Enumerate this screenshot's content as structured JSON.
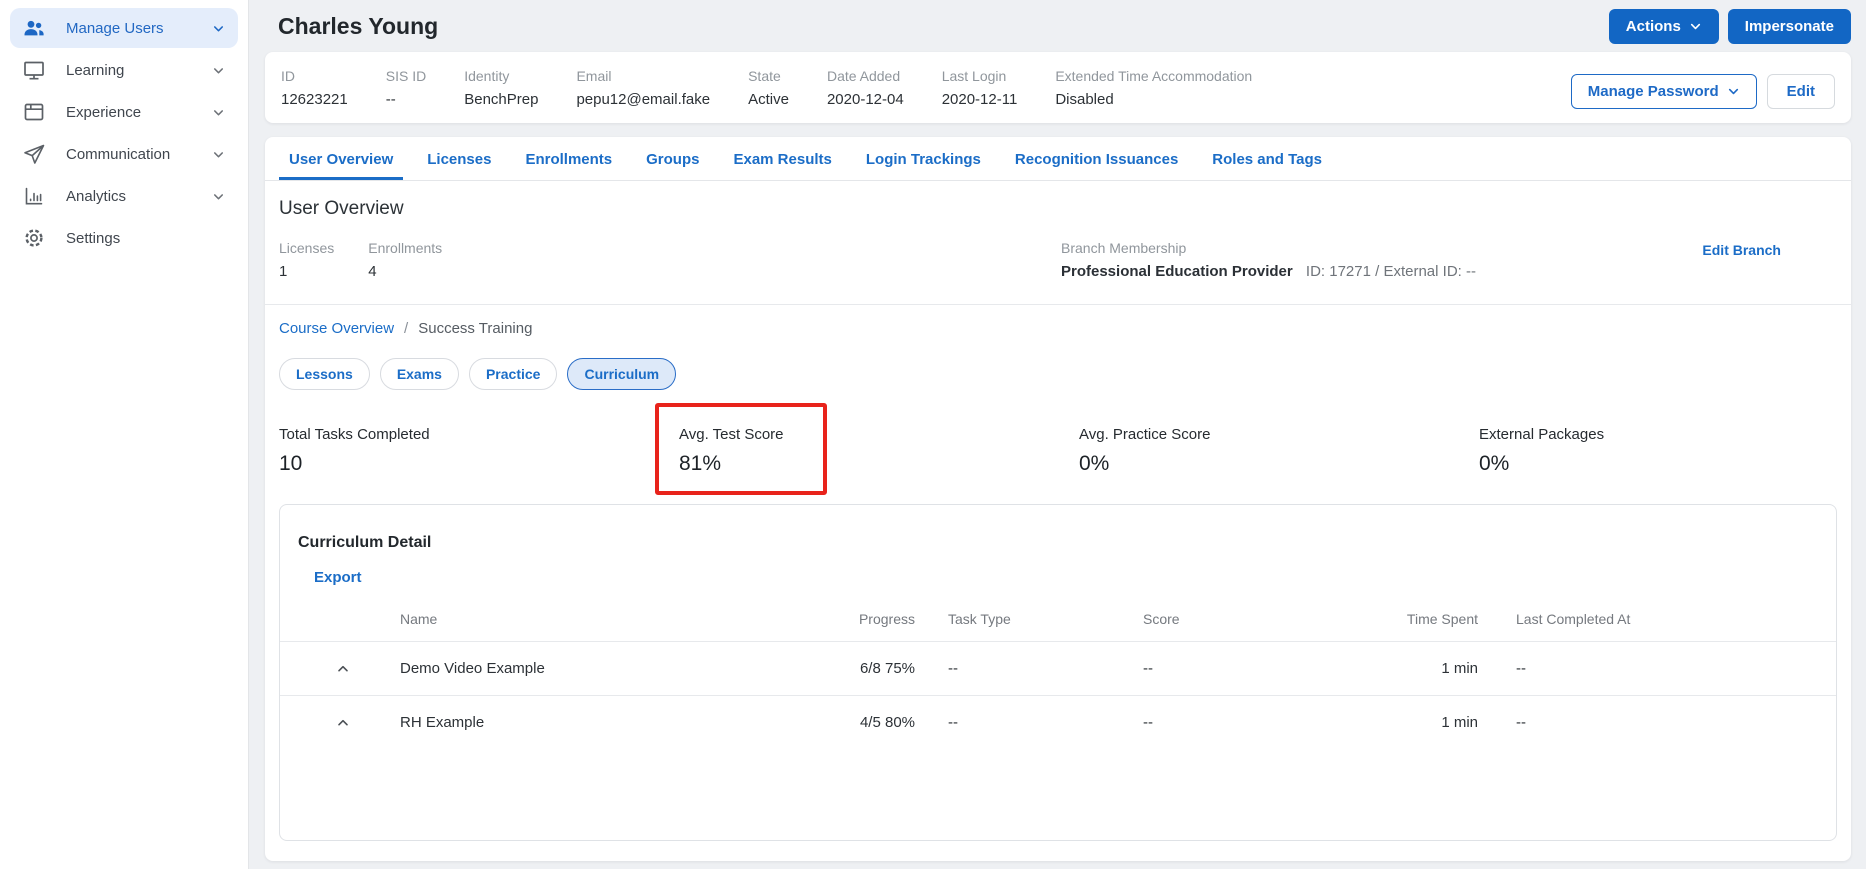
{
  "colors": {
    "primary_blue": "#1266c4",
    "link_blue": "#1b6dc7",
    "annotation_red": "#e8231b",
    "active_nav_bg": "#e4edfb",
    "page_bg": "#eef0f3"
  },
  "sidebar": {
    "items": [
      {
        "label": "Manage Users",
        "icon": "users-icon",
        "active": true
      },
      {
        "label": "Learning",
        "icon": "monitor-icon",
        "active": false
      },
      {
        "label": "Experience",
        "icon": "browser-icon",
        "active": false
      },
      {
        "label": "Communication",
        "icon": "paper-plane-icon",
        "active": false
      },
      {
        "label": "Analytics",
        "icon": "bar-chart-icon",
        "active": false
      },
      {
        "label": "Settings",
        "icon": "gear-icon",
        "active": false
      }
    ]
  },
  "header": {
    "title": "Charles Young",
    "actions_label": "Actions",
    "impersonate_label": "Impersonate"
  },
  "info_bar": {
    "fields": [
      {
        "label": "ID",
        "value": "12623221"
      },
      {
        "label": "SIS ID",
        "value": "--"
      },
      {
        "label": "Identity",
        "value": "BenchPrep"
      },
      {
        "label": "Email",
        "value": "pepu12@email.fake"
      },
      {
        "label": "State",
        "value": "Active"
      },
      {
        "label": "Date Added",
        "value": "2020-12-04"
      },
      {
        "label": "Last Login",
        "value": "2020-12-11"
      },
      {
        "label": "Extended Time Accommodation",
        "value": "Disabled"
      }
    ],
    "manage_password_label": "Manage Password",
    "edit_label": "Edit"
  },
  "tabs": {
    "items": [
      {
        "label": "User Overview",
        "active": true
      },
      {
        "label": "Licenses",
        "active": false
      },
      {
        "label": "Enrollments",
        "active": false
      },
      {
        "label": "Groups",
        "active": false
      },
      {
        "label": "Exam Results",
        "active": false
      },
      {
        "label": "Login Trackings",
        "active": false
      },
      {
        "label": "Recognition Issuances",
        "active": false
      },
      {
        "label": "Roles and Tags",
        "active": false
      }
    ]
  },
  "overview": {
    "section_title": "User Overview",
    "stats": [
      {
        "label": "Licenses",
        "value": "1"
      },
      {
        "label": "Enrollments",
        "value": "4"
      }
    ],
    "branch": {
      "label": "Branch Membership",
      "name": "Professional Education Provider",
      "detail": "ID: 17271 / External ID: --",
      "edit_label": "Edit Branch"
    }
  },
  "breadcrumb": {
    "link": "Course Overview",
    "separator": "/",
    "current": "Success Training"
  },
  "pills": [
    {
      "label": "Lessons",
      "selected": false
    },
    {
      "label": "Exams",
      "selected": false
    },
    {
      "label": "Practice",
      "selected": false
    },
    {
      "label": "Curriculum",
      "selected": true
    }
  ],
  "summary_stats": [
    {
      "label": "Total Tasks Completed",
      "value": "10",
      "highlighted": false
    },
    {
      "label": "Avg. Test Score",
      "value": "81%",
      "highlighted": true
    },
    {
      "label": "Avg. Practice Score",
      "value": "0%",
      "highlighted": false
    },
    {
      "label": "External Packages",
      "value": "0%",
      "highlighted": false
    }
  ],
  "curriculum": {
    "title": "Curriculum Detail",
    "export_label": "Export",
    "columns": [
      "Name",
      "Progress",
      "Task Type",
      "Score",
      "Time Spent",
      "Last Completed At"
    ],
    "rows": [
      {
        "name": "Demo Video Example",
        "progress": "6/8 75%",
        "task_type": "--",
        "score": "--",
        "time_spent": "1 min",
        "last_completed_at": "--"
      },
      {
        "name": "RH Example",
        "progress": "4/5 80%",
        "task_type": "--",
        "score": "--",
        "time_spent": "1 min",
        "last_completed_at": "--"
      }
    ]
  }
}
